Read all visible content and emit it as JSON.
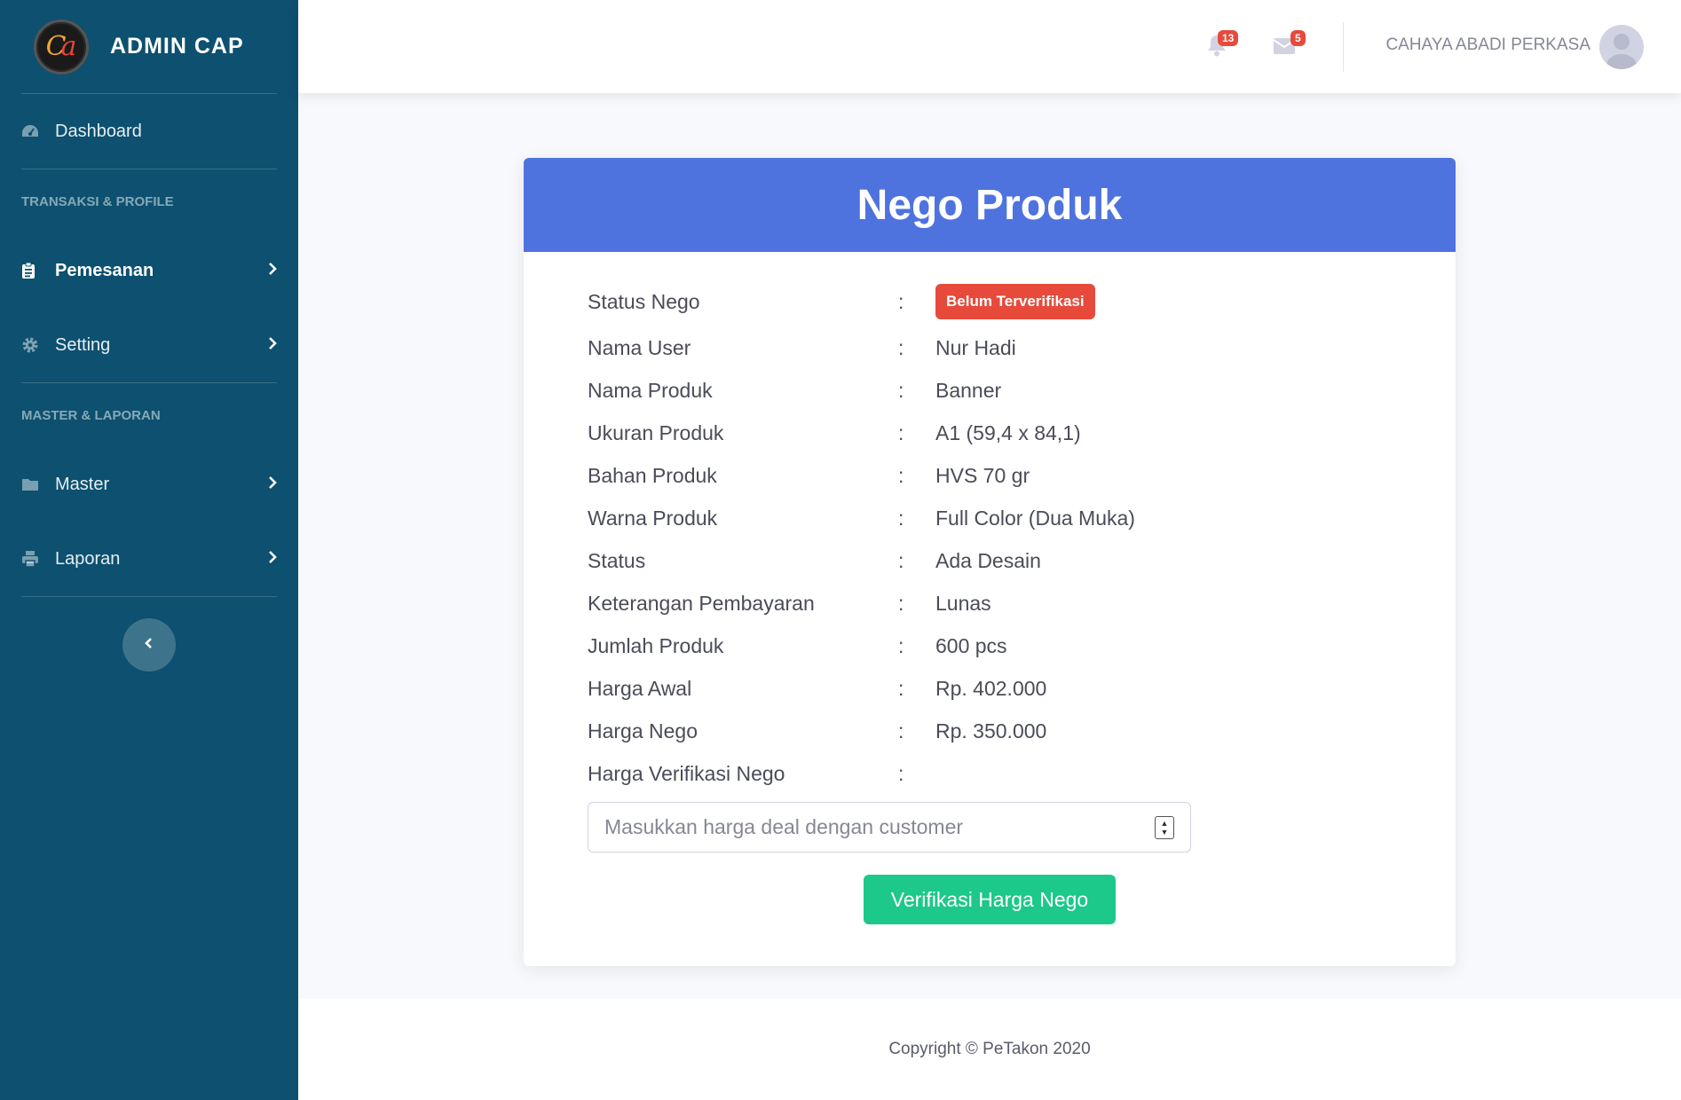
{
  "brand": {
    "logo_text": "Ca",
    "title": "ADMIN CAP"
  },
  "sidebar": {
    "dashboard": {
      "label": "Dashboard",
      "icon": "tachometer-icon"
    },
    "heading1": "TRANSAKSI & PROFILE",
    "pemesanan": {
      "label": "Pemesanan",
      "icon": "clipboard-icon"
    },
    "setting": {
      "label": "Setting",
      "icon": "gear-icon"
    },
    "heading2": "MASTER & LAPORAN",
    "master": {
      "label": "Master",
      "icon": "folder-icon"
    },
    "laporan": {
      "label": "Laporan",
      "icon": "printer-icon"
    },
    "toggle_icon": "chevron-left-icon"
  },
  "topbar": {
    "alerts_count": "13",
    "messages_count": "5",
    "user_name": "CAHAYA ABADI PERKASA"
  },
  "card": {
    "title": "Nego Produk",
    "fields": [
      {
        "label": "Status Nego",
        "sep": ":",
        "value": "Belum Terverifikasi"
      },
      {
        "label": "Nama User",
        "sep": ":",
        "value": "Nur Hadi"
      },
      {
        "label": "Nama Produk",
        "sep": ":",
        "value": "Banner"
      },
      {
        "label": "Ukuran Produk",
        "sep": ":",
        "value": "A1 (59,4 x 84,1)"
      },
      {
        "label": "Bahan Produk",
        "sep": ":",
        "value": "HVS 70 gr"
      },
      {
        "label": "Warna Produk",
        "sep": ":",
        "value": "Full Color (Dua Muka)"
      },
      {
        "label": "Status",
        "sep": ":",
        "value": "Ada Desain"
      },
      {
        "label": "Keterangan Pembayaran",
        "sep": ":",
        "value": "Lunas"
      },
      {
        "label": "Jumlah Produk",
        "sep": ":",
        "value": "600 pcs"
      },
      {
        "label": "Harga Awal",
        "sep": ":",
        "value": "Rp. 402.000"
      },
      {
        "label": "Harga Nego",
        "sep": ":",
        "value": "Rp. 350.000"
      },
      {
        "label": "Harga Verifikasi Nego",
        "sep": ":",
        "value": ""
      }
    ],
    "input_placeholder": "Masukkan harga deal dengan customer",
    "button_label": "Verifikasi Harga Nego"
  },
  "footer": {
    "text": "Copyright © PeTakon 2020"
  },
  "colors": {
    "sidebar": "#0d506f",
    "header": "#4e73df",
    "badge": "#e74a3b",
    "button": "#1cc88a"
  }
}
